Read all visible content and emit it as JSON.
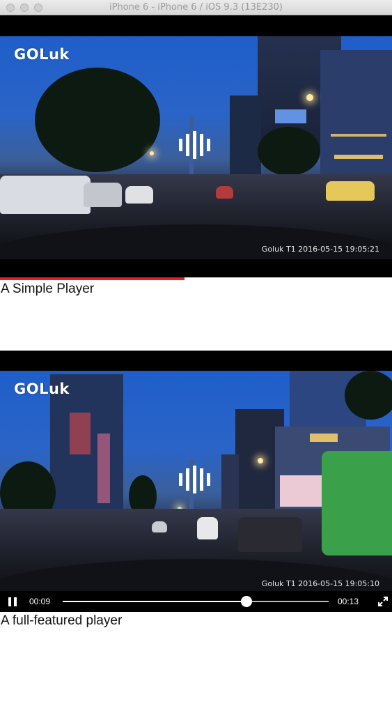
{
  "window": {
    "title": "iPhone 6 - iPhone 6 / iOS 9.3 (13E230)"
  },
  "simple_player": {
    "logo": "GOLuk",
    "stamp": "Goluk T1 2016-05-15 19:05:21",
    "progress_fraction": 0.47,
    "caption": "A Simple Player"
  },
  "full_player": {
    "logo": "GOLuk",
    "stamp": "Goluk T1 2016-05-15 19:05:10",
    "current_time": "00:09",
    "duration": "00:13",
    "progress_fraction": 0.69,
    "caption": "A full-featured player"
  },
  "icons": {
    "play_state": "pause-icon",
    "fullscreen": "fullscreen-icon",
    "audio_indicator": "audio-wave-icon"
  },
  "colors": {
    "progress_red": "#f01b1b",
    "player_background": "#000000"
  }
}
